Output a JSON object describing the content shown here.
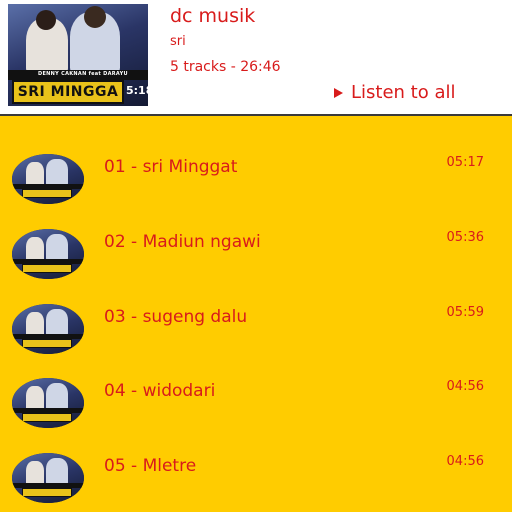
{
  "album": {
    "title": "dc musik",
    "artist": "sri",
    "track_info": "5 tracks - 26:46",
    "listen_label": "Listen to all",
    "art_title": "SRI MINGGA",
    "art_duration": "5:18",
    "art_caption": "DENNY CAKNAN feat DARAYU"
  },
  "tracks": [
    {
      "title": "01 - sri Minggat",
      "duration": "05:17"
    },
    {
      "title": "02 - Madiun ngawi",
      "duration": "05:36"
    },
    {
      "title": "03 - sugeng dalu",
      "duration": "05:59"
    },
    {
      "title": "04 - widodari",
      "duration": "04:56"
    },
    {
      "title": "05 - Mletre",
      "duration": "04:56"
    }
  ],
  "colors": {
    "accent": "#d81b1b",
    "list_background": "#ffcc00"
  }
}
